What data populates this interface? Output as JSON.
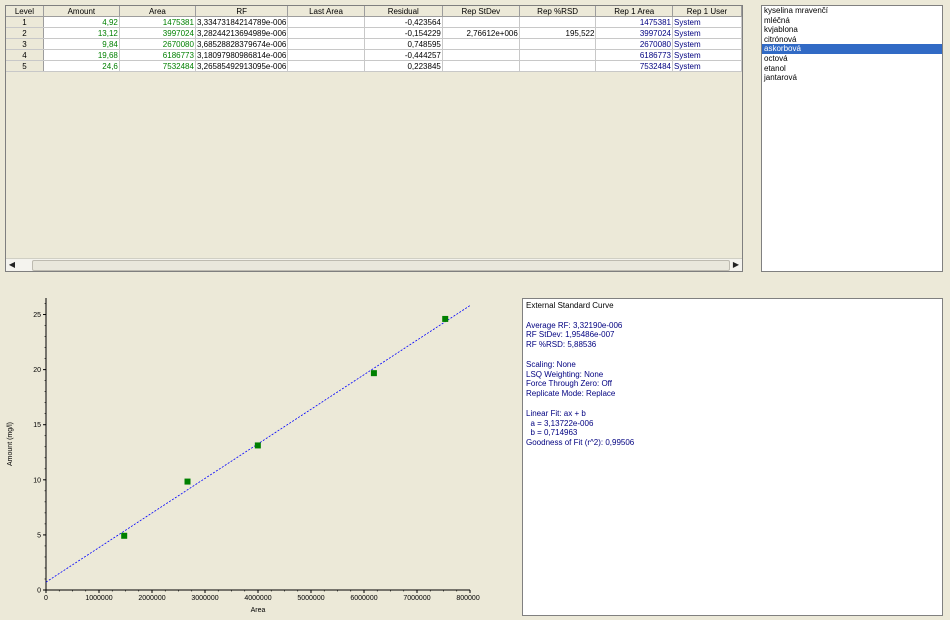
{
  "table": {
    "columns": [
      "Level",
      "Amount",
      "Area",
      "RF",
      "Last Area",
      "Residual",
      "Rep StDev",
      "Rep %RSD",
      "Rep 1 Area",
      "Rep 1 User"
    ],
    "rows": [
      [
        "1",
        "4,92",
        "1475381",
        "3,33473184214789e-006",
        "",
        "-0,423564",
        "",
        "",
        "1475381",
        "System"
      ],
      [
        "2",
        "13,12",
        "3997024",
        "3,28244213694989e-006",
        "",
        "-0,154229",
        "2,76612e+006",
        "195,522",
        "3997024",
        "System"
      ],
      [
        "3",
        "9,84",
        "2670080",
        "3,68528828379674e-006",
        "",
        "0,748595",
        "",
        "",
        "2670080",
        "System"
      ],
      [
        "4",
        "19,68",
        "6186773",
        "3,18097980986814e-006",
        "",
        "-0,444257",
        "",
        "",
        "6186773",
        "System"
      ],
      [
        "5",
        "24,6",
        "7532484",
        "3,26585492913095e-006",
        "",
        "0,223845",
        "",
        "",
        "7532484",
        "System"
      ]
    ]
  },
  "component_list": {
    "items": [
      "kyselina mravenčí",
      "mléčná",
      "kvjablona",
      "citrónová",
      "askorbová",
      "octová",
      "etanol",
      "jantarová"
    ],
    "selected_index": 4
  },
  "curve_info": {
    "title": "External Standard Curve",
    "block1": [
      "Average RF: 3,32190e-006",
      "RF StDev: 1,95486e-007",
      "RF %RSD: 5,88536"
    ],
    "block2": [
      "Scaling: None",
      "LSQ Weighting: None",
      "Force Through Zero: Off",
      "Replicate Mode: Replace"
    ],
    "block3": [
      "Linear Fit: ax + b",
      "  a = 3,13722e-006",
      "  b = 0,714963",
      "Goodness of Fit (r^2): 0,99506"
    ]
  },
  "chart_data": {
    "type": "scatter",
    "xlabel": "Area",
    "ylabel": "Amount (mg/l)",
    "xlim": [
      0,
      8000000
    ],
    "ylim": [
      0,
      26.5
    ],
    "x_ticks": [
      "0",
      "1000000",
      "2000000",
      "3000000",
      "4000000",
      "5000000",
      "6000000",
      "7000000",
      "8000000"
    ],
    "y_ticks": [
      "0",
      "5",
      "10",
      "15",
      "20",
      "25"
    ],
    "points": [
      [
        1475381,
        4.92
      ],
      [
        2670080,
        9.84
      ],
      [
        3997024,
        13.12
      ],
      [
        6186773,
        19.68
      ],
      [
        7532484,
        24.6
      ]
    ],
    "fit_line": {
      "a": 3.13722e-06,
      "b": 0.714963
    },
    "marker_color": "#008000",
    "line_color": "#0000ff"
  },
  "colors": {
    "selection": "#316ac5",
    "background": "#ece9d8"
  }
}
